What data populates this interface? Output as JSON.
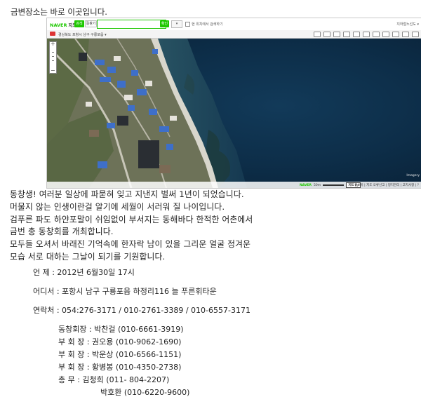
{
  "headline": "금변장소는 바로 이곳입니다.",
  "map": {
    "logo_brand": "NAVER",
    "logo_service": "지도",
    "search_button": "검색",
    "route_button": "길찾기",
    "search_placeholder": "",
    "confirm_button": "확인",
    "sort_select": "▾",
    "checkbox_label": "현 위치에서 검색하기",
    "top_right_link": "지하철노선도 ▾",
    "breadcrumb": "경상북도 포항시 남구 구룡포읍 ▾",
    "imagery_label": "Imagery",
    "footer_logo": "NAVER",
    "scale_label": "50m",
    "scale_box": "지도 by",
    "footer_links": "지도원보이 | 지도 오류신고 | 정치관리 | 고지사항 | ?"
  },
  "paragraphs": [
    "동창생! 여러분 일상에 파묻혀 잊고 지낸지 벌써 1년이 되었습니다.",
    "머물지 않는 인생이란걸 알기에 세월이 서러워 질 나이입니다.",
    "검푸른 파도 하얀포말이 쉬임없이 부서지는 동해바다 한적한 어촌에서",
    "금번 총 동창회를 개최합니다.",
    "모두들 오셔서 바래진 기억속에 한자락 남이 있을 그리운 얼굴 정겨운",
    "모습 서로 대하는 그날이 되기를 기원합니다."
  ],
  "info": {
    "when": "언    제 : 2012년 6월30일 17시",
    "where": "어디서 : 포항시 남구 구룡포읍  하정리116 늘 푸른휘타운",
    "contact": "연락처 : 054:276-3171 / 010-2761-3389 / 010-6557-3171"
  },
  "roster": [
    "동창회장 : 박찬걸 (010-6661-3919)",
    "부  회  장 : 권오용 (010-9062-1690)",
    "부  회  장 : 박운상 (010-6566-1151)",
    "부  회  장 : 황병봉 (010-4350-2738)",
    "총       무 : 김청희 (011- 804-2207)",
    "박호환 (010-6220-9600)"
  ]
}
